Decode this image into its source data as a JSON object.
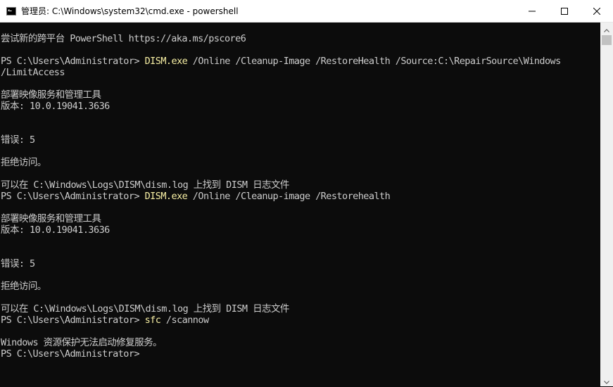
{
  "window": {
    "title": "管理员: C:\\Windows\\system32\\cmd.exe - powershell",
    "minimize_glyph": "minimize-icon",
    "maximize_glyph": "maximize-icon",
    "close_glyph": "close-icon"
  },
  "console": {
    "lines": [
      {
        "type": "text",
        "text": "尝试新的跨平台 PowerShell https://aka.ms/pscore6"
      },
      {
        "type": "blank",
        "text": ""
      },
      {
        "type": "prompt",
        "prompt": "PS C:\\Users\\Administrator> ",
        "command": "DISM.exe",
        "args": " /Online /Cleanup-Image /RestoreHealth /Source:C:\\RepairSource\\Windows"
      },
      {
        "type": "text",
        "text": "/LimitAccess"
      },
      {
        "type": "blank",
        "text": ""
      },
      {
        "type": "text",
        "text": "部署映像服务和管理工具"
      },
      {
        "type": "text",
        "text": "版本: 10.0.19041.3636"
      },
      {
        "type": "blank",
        "text": ""
      },
      {
        "type": "blank",
        "text": ""
      },
      {
        "type": "text",
        "text": "错误: 5"
      },
      {
        "type": "blank",
        "text": ""
      },
      {
        "type": "text",
        "text": "拒绝访问。"
      },
      {
        "type": "blank",
        "text": ""
      },
      {
        "type": "text",
        "text": "可以在 C:\\Windows\\Logs\\DISM\\dism.log 上找到 DISM 日志文件"
      },
      {
        "type": "prompt",
        "prompt": "PS C:\\Users\\Administrator> ",
        "command": "DISM.exe",
        "args": " /Online /Cleanup-image /Restorehealth"
      },
      {
        "type": "blank",
        "text": ""
      },
      {
        "type": "text",
        "text": "部署映像服务和管理工具"
      },
      {
        "type": "text",
        "text": "版本: 10.0.19041.3636"
      },
      {
        "type": "blank",
        "text": ""
      },
      {
        "type": "blank",
        "text": ""
      },
      {
        "type": "text",
        "text": "错误: 5"
      },
      {
        "type": "blank",
        "text": ""
      },
      {
        "type": "text",
        "text": "拒绝访问。"
      },
      {
        "type": "blank",
        "text": ""
      },
      {
        "type": "text",
        "text": "可以在 C:\\Windows\\Logs\\DISM\\dism.log 上找到 DISM 日志文件"
      },
      {
        "type": "prompt",
        "prompt": "PS C:\\Users\\Administrator> ",
        "command": "sfc",
        "args": " /scannow"
      },
      {
        "type": "blank",
        "text": ""
      },
      {
        "type": "text",
        "text": "Windows 资源保护无法启动修复服务。"
      },
      {
        "type": "prompt",
        "prompt": "PS C:\\Users\\Administrator>",
        "command": "",
        "args": ""
      }
    ]
  },
  "colors": {
    "background": "#0c0c0c",
    "foreground": "#cccccc",
    "command": "#f9f1a5"
  }
}
